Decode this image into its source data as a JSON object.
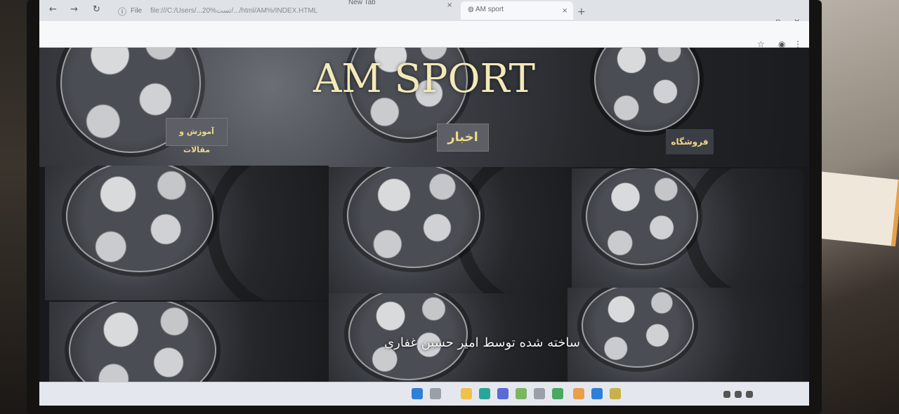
{
  "browser": {
    "tabs": [
      {
        "label": "New Tab",
        "active": false
      },
      {
        "label": "AM sport",
        "active": true
      }
    ],
    "new_tab_glyph": "+",
    "address_prefix": "File",
    "url": "file:///C:/Users/...20%تست/.../html/AM%/INDEX.HTML",
    "icons": [
      "back-icon",
      "forward-icon",
      "reload-icon",
      "info-icon",
      "star-icon",
      "extension-icon",
      "menu-icon"
    ]
  },
  "page": {
    "title": "AM SPORT",
    "nav": {
      "articles": "آموزش و مقالات",
      "news": "اخبار",
      "shop": "فروشگاه"
    },
    "footer": "ساخته شده توسط امیر حسین غفاری"
  },
  "colors": {
    "title": "#f3e9b8",
    "nav_text": "#f0d98a",
    "nav_bg": "#5c5f66",
    "tile_dark": "#1a1b1e"
  }
}
